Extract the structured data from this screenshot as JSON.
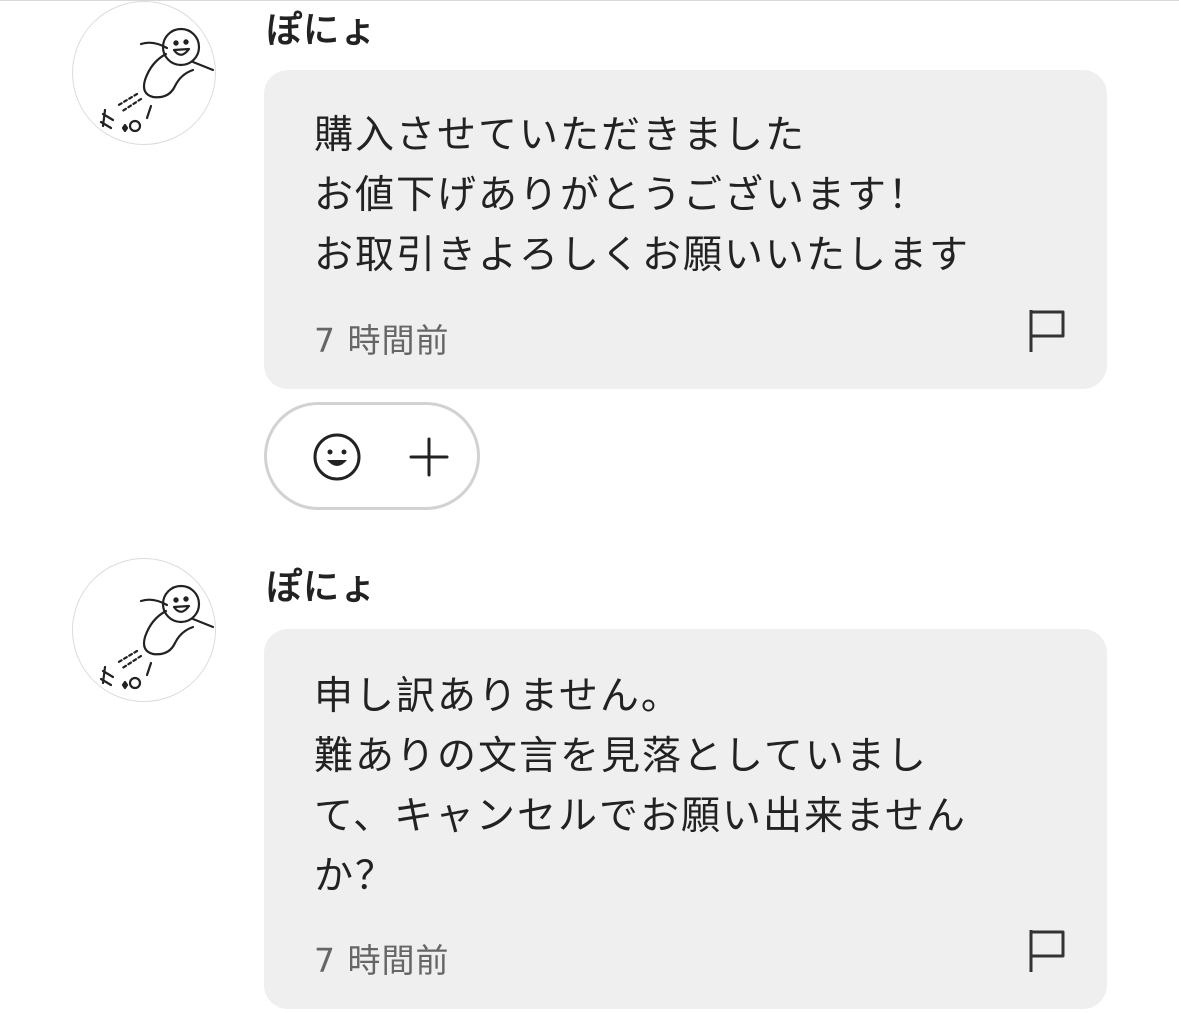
{
  "messages": [
    {
      "username": "ぽにょ",
      "lines": [
        "購入させていただきました",
        "お値下げありがとうございます！",
        "お取引きよろしくお願いいたします"
      ],
      "timestamp": "7 時間前"
    },
    {
      "username": "ぽにょ",
      "lines": [
        "申し訳ありません。",
        "難ありの文言を見落としていまし",
        "て、キャンセルでお願い出来ません",
        "か？"
      ],
      "timestamp": "7 時間前"
    }
  ],
  "icons": {
    "avatar": "cartoon-character-avatar",
    "report": "flag-icon",
    "reaction_emoji": "smiley-face-icon",
    "reaction_add": "plus-icon"
  },
  "colors": {
    "bubble_background": "#efefef",
    "text": "#222222",
    "timestamp": "#666666",
    "reaction_border": "#d2d2d2"
  }
}
